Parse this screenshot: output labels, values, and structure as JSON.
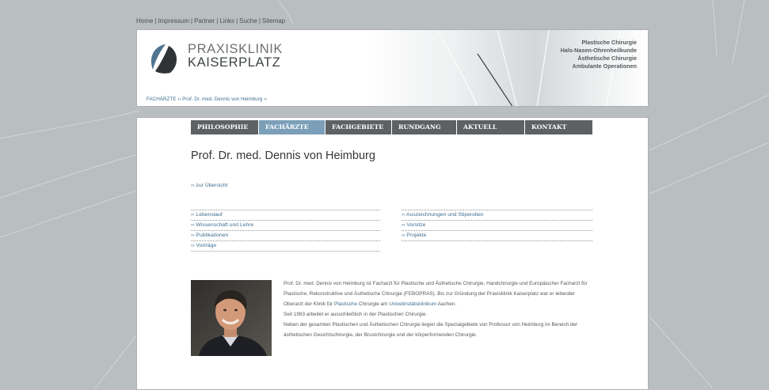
{
  "top_nav": {
    "items": [
      "Home",
      "Impressum",
      "Partner",
      "Links",
      "Suche",
      "Sitemap"
    ],
    "separator": "|"
  },
  "header": {
    "logo_line1": "PRAXISKLINIK",
    "logo_line2": "KAISERPLATZ",
    "specialties": [
      "Plastische Chirurgie",
      "Hals-Nasen-Ohrenheilkunde",
      "Ästhetische Chirurgie",
      "Ambulante Operationen"
    ],
    "breadcrumb": {
      "section": "FACHÄRZTE",
      "page": "Prof. Dr. med. Dennis von Heimburg",
      "separator": "››"
    }
  },
  "main_nav": {
    "items": [
      "PHILOSOPHIE",
      "FACHÄRZTE",
      "FACHGEBIETE",
      "RUNDGANG",
      "AKTUELL",
      "KONTAKT"
    ],
    "active_index": 1
  },
  "page_title": "Prof. Dr. med. Dennis von Heimburg",
  "overview_link": "›› zur Übersicht",
  "links": {
    "left": [
      "›› Lebenslauf",
      "›› Wissenschaft und Lehre",
      "›› Publikationen",
      "›› Vorträge"
    ],
    "right": [
      "›› Auszeichnungen und Stipendien",
      "›› Vorsitze",
      "›› Projekte"
    ]
  },
  "bio": {
    "p1_a": "Prof. Dr. med. Dennis von Heimburg ist Facharzt für Plastische und Ästhetische Chirurgie, Handchirurgie und Europäischer Facharzt für Plastische, Rekonstruktive und Ästhetische Chirurgie (FEBOPRAS). Bis zur Gründung der Praxisklinik Kaiserplatz war er leitender Oberarzt der Klinik für ",
    "p1_link1": "Plastische",
    "p1_b": " Chirurgie am ",
    "p1_link2": "Univebrsitätsklinikum",
    "p1_c": " Aachen.",
    "p2": "Seit 1993 arbeitet er ausschließlich in der Plastischen Chirurgie.",
    "p3": "Neben der gesamten Plastischen und Ästhetischen Chirurgie liegen die Spezialgebiete von Professor von Heimburg im Bereich der ästhetischen Gesichtschirurgie, der Brustchirurgie und der körperformenden Chirurgie."
  },
  "colors": {
    "page_background": "#b9bec1",
    "nav_background": "#5d6163",
    "nav_active": "#7b9fb8",
    "link": "#3f6f92",
    "logo_blue": "#4f7590",
    "logo_dark": "#2f3335"
  }
}
